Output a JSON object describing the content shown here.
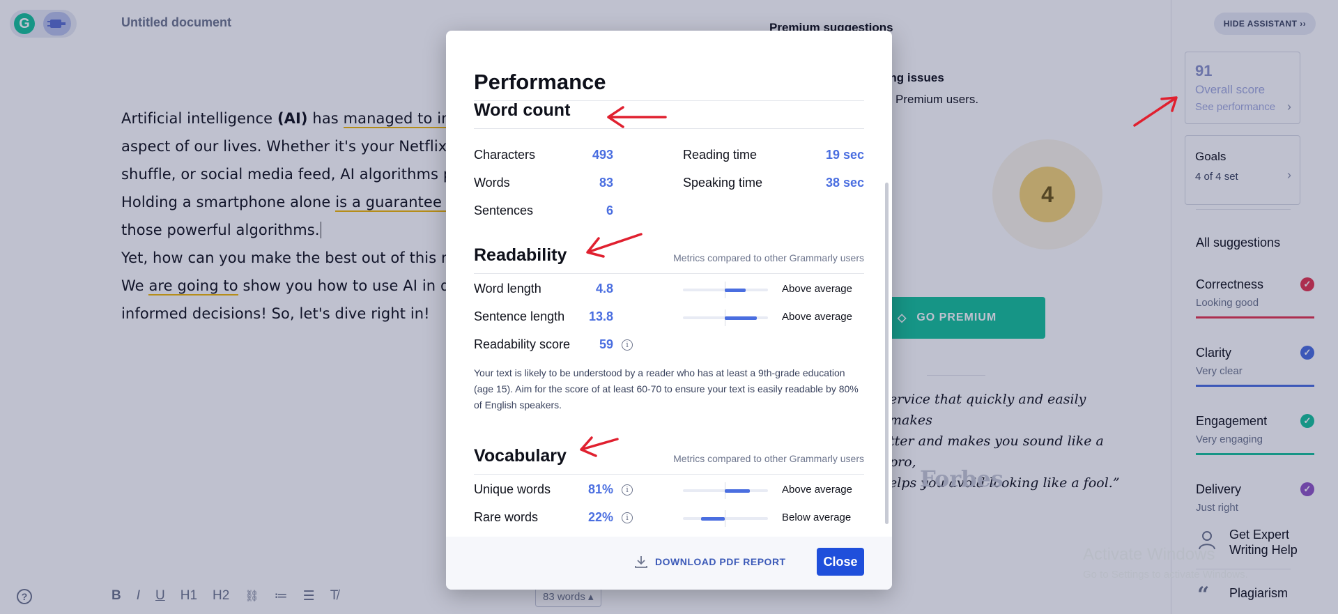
{
  "editor": {
    "doc_title": "Untitled document",
    "lines": [
      {
        "pre": "Artificial intelligence ",
        "bold": "(AI)",
        "mid": " has ",
        "ul": "managed to inte",
        "post": ""
      },
      {
        "pre": "aspect of our lives. Whether it's your Netflix re",
        "bold": "",
        "mid": "",
        "ul": "",
        "post": ""
      },
      {
        "pre": "shuffle, or social media feed, AI algorithms pro",
        "bold": "",
        "mid": "",
        "ul": "",
        "post": ""
      },
      {
        "pre": "Holding a smartphone alone ",
        "bold": "",
        "mid": "",
        "ul": "is a guarantee tha",
        "post": ""
      },
      {
        "pre": "those powerful algorithms.",
        "bold": "",
        "mid": "",
        "ul": "",
        "post": ""
      },
      {
        "pre": "Yet, how can you make the best out of this nev",
        "bold": "",
        "mid": "",
        "ul": "",
        "post": ""
      },
      {
        "pre": "We ",
        "bold": "",
        "mid": "",
        "ul": "are going to",
        "post": " show you how to use AI in dig"
      },
      {
        "pre": "informed decisions! So, let's dive right in!",
        "bold": "",
        "mid": "",
        "ul": "",
        "post": ""
      }
    ],
    "toolbar": {
      "bold": "B",
      "italic": "I",
      "underline": "U",
      "h1": "H1",
      "h2": "H2",
      "link": "🔗",
      "ol": "≔",
      "ul": "☰",
      "clear": "⨯"
    },
    "word_count_pill": "83 words"
  },
  "premium": {
    "title": "Premium suggestions",
    "issues": "l writing issues",
    "only": "nly for Premium users.",
    "s_fragment": "s",
    "score": "4",
    "go_premium": "GO PREMIUM",
    "quote": "ervice that quickly and easily makes tter and makes you sound like a pro, elps you avoid looking like a fool.”",
    "quote_lines": [
      "ervice that quickly and easily makes",
      "tter and makes you sound like a pro,",
      "elps you avoid looking like a fool.”"
    ],
    "forbes": "Forbes"
  },
  "sidebar": {
    "hide_assistant": "HIDE ASSISTANT",
    "score_num": "91",
    "score_label": "Overall score",
    "score_sub": "See performance",
    "goals_title": "Goals",
    "goals_sub": "4 of 4 set",
    "all_suggestions": "All suggestions",
    "categories": [
      {
        "name": "Correctness",
        "status": "Looking good",
        "color": "#e5344e"
      },
      {
        "name": "Clarity",
        "status": "Very clear",
        "color": "#4a6ee0"
      },
      {
        "name": "Engagement",
        "status": "Very engaging",
        "color": "#15c39a"
      },
      {
        "name": "Delivery",
        "status": "Just right",
        "color": "#9155c5"
      }
    ],
    "expert_line1": "Get Expert",
    "expert_line2": "Writing Help",
    "plagiarism": "Plagiarism",
    "activate_title": "Activate Windows",
    "activate_sub": "Go to Settings to activate Windows."
  },
  "modal": {
    "title": "Performance",
    "word_count": {
      "heading": "Word count",
      "characters_label": "Characters",
      "characters": "493",
      "words_label": "Words",
      "words": "83",
      "sentences_label": "Sentences",
      "sentences": "6",
      "reading_label": "Reading time",
      "reading": "19 sec",
      "speaking_label": "Speaking time",
      "speaking": "38 sec"
    },
    "readability": {
      "heading": "Readability",
      "compare": "Metrics compared to other Grammarly users",
      "word_length_label": "Word length",
      "word_length": "4.8",
      "word_length_avg": "Above average",
      "sentence_length_label": "Sentence length",
      "sentence_length": "13.8",
      "sentence_length_avg": "Above average",
      "score_label": "Readability score",
      "score": "59",
      "description": "Your text is likely to be understood by a reader who has at least a 9th-grade education (age 15). Aim for the score of at least 60-70 to ensure your text is easily readable by 80% of English speakers."
    },
    "vocabulary": {
      "heading": "Vocabulary",
      "compare": "Metrics compared to other Grammarly users",
      "unique_label": "Unique words",
      "unique": "81%",
      "unique_avg": "Above average",
      "rare_label": "Rare words",
      "rare": "22%",
      "rare_avg": "Below average"
    },
    "download": "DOWNLOAD PDF REPORT",
    "close": "Close"
  },
  "colors": {
    "accent": "#4a6ee0",
    "primary_button": "#1f4fdb",
    "premium_green": "#15c39a",
    "arrow_red": "#e0202f"
  }
}
